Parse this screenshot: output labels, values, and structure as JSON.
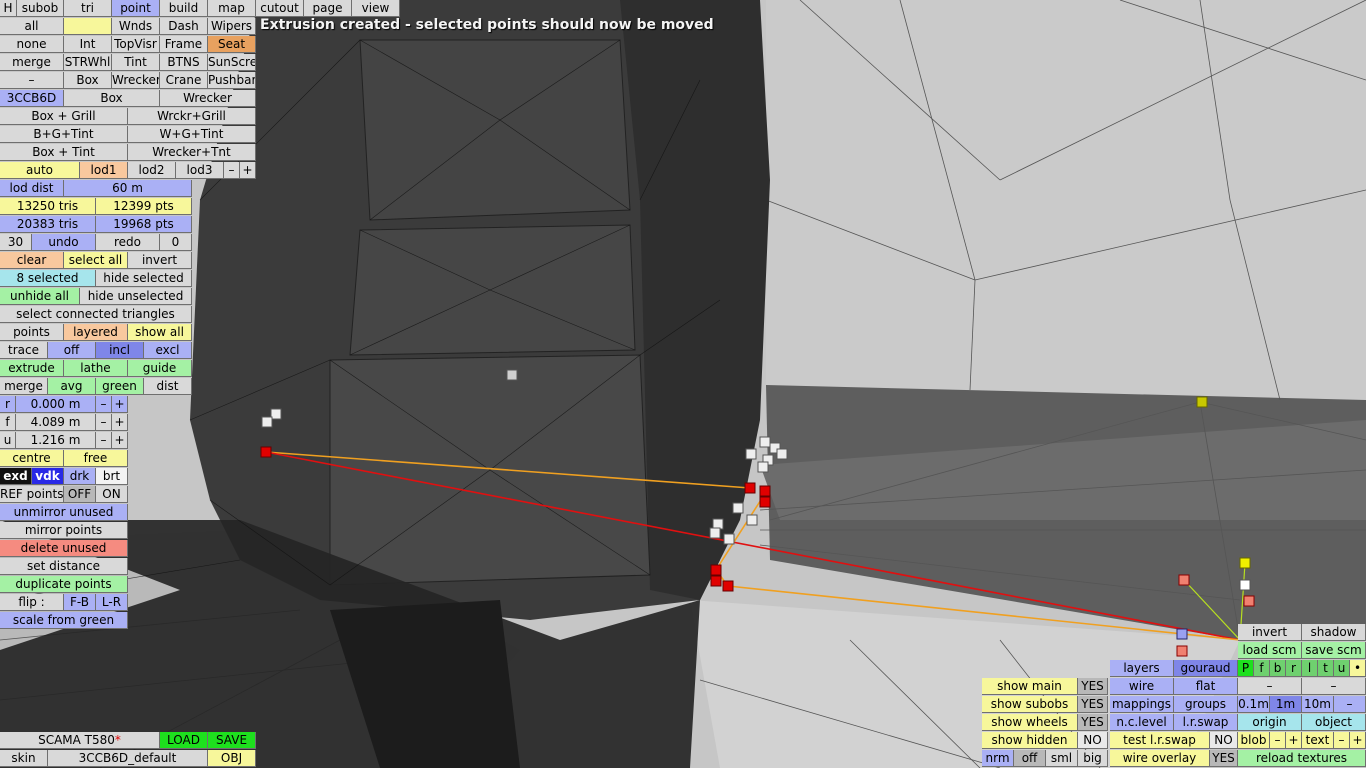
{
  "message": "Extrusion created - selected points should now be moved",
  "top": {
    "h": "H",
    "subob": "subob",
    "tri": "tri",
    "point": "point",
    "build": "build",
    "map": "map",
    "cutout": "cutout",
    "page": "page",
    "view": "view"
  },
  "parts": {
    "all": "all",
    "wnds": "Wnds",
    "dash": "Dash",
    "wipers": "Wipers",
    "none": "none",
    "int": "Int",
    "topvisr": "TopVisr",
    "frame": "Frame",
    "seat": "Seat",
    "merge": "merge",
    "strwhl": "STRWhl",
    "tint": "Tint",
    "btns": "BTNS",
    "sunscre": "SunScre",
    "dash2": "–",
    "box": "Box",
    "wrecker": "Wrecker",
    "crane": "Crane",
    "pushbar": "Pushbar"
  },
  "variants": {
    "code": "3CCB6D",
    "box": "Box",
    "wrecker": "Wrecker",
    "box_grill": "Box + Grill",
    "wrckr_grill": "Wrckr+Grill",
    "bg_tint": "B+G+Tint",
    "wg_tint": "W+G+Tint",
    "box_tint": "Box + Tint",
    "wrecker_tnt": "Wrecker+Tnt"
  },
  "lod": {
    "auto": "auto",
    "lod1": "lod1",
    "lod2": "lod2",
    "lod3": "lod3",
    "minus": "–",
    "plus": "+",
    "dist_label": "lod dist",
    "dist_value": "60 m"
  },
  "stats": {
    "tris1": "13250 tris",
    "pts1": "12399 pts",
    "tris2": "20383 tris",
    "pts2": "19968 pts"
  },
  "undo": {
    "count": "30",
    "undo": "undo",
    "redo": "redo",
    "redo_count": "0"
  },
  "select": {
    "clear": "clear",
    "select_all": "select all",
    "invert": "invert",
    "selected": "8 selected",
    "hide_selected": "hide selected",
    "unhide_all": "unhide all",
    "hide_unselected": "hide unselected",
    "connected": "select connected triangles",
    "points": "points",
    "layered": "layered",
    "show_all": "show all"
  },
  "trace": {
    "trace": "trace",
    "off": "off",
    "incl": "incl",
    "excl": "excl"
  },
  "ops": {
    "extrude": "extrude",
    "lathe": "lathe",
    "guide": "guide",
    "merge": "merge",
    "avg": "avg",
    "green": "green",
    "dist": "dist"
  },
  "coords": {
    "r_label": "r",
    "r_value": "0.000 m",
    "f_label": "f",
    "f_value": "4.089 m",
    "u_label": "u",
    "u_value": "1.216 m",
    "minus": "–",
    "plus": "+"
  },
  "pivot": {
    "centre": "centre",
    "free": "free"
  },
  "shade": {
    "exd": "exd",
    "vdk": "vdk",
    "drk": "drk",
    "brt": "brt"
  },
  "refpoints": {
    "label": "REF points",
    "off": "OFF",
    "on": "ON"
  },
  "actions": {
    "unmirror": "unmirror unused",
    "mirror": "mirror points",
    "delete": "delete unused",
    "set_distance": "set distance",
    "duplicate": "duplicate points",
    "flip": "flip :",
    "fb": "F-B",
    "lr": "L-R",
    "scale": "scale from green"
  },
  "file": {
    "model": "SCAMA T580",
    "modified": "*",
    "load": "LOAD",
    "save": "SAVE",
    "skin": "skin",
    "skin_name": "3CCB6D_default",
    "obj": "OBJ"
  },
  "display": {
    "show_main": "show main",
    "show_main_v": "YES",
    "show_subobs": "show subobs",
    "show_subobs_v": "YES",
    "show_wheels": "show wheels",
    "show_wheels_v": "YES",
    "show_hidden": "show hidden",
    "show_hidden_v": "NO",
    "nrm": "nrm",
    "off": "off",
    "sml": "sml",
    "big": "big"
  },
  "render": {
    "layers": "layers",
    "gouraud": "gouraud",
    "wire": "wire",
    "flat": "flat",
    "mappings": "mappings",
    "groups": "groups",
    "nclevel": "n.c.level",
    "lrswap": "l.r.swap",
    "test_lrswap": "test l.r.swap",
    "test_lrswap_v": "NO",
    "wire_overlay": "wire overlay",
    "wire_overlay_v": "YES"
  },
  "tools": {
    "invert": "invert",
    "shadow": "shadow",
    "load_scm": "load scm",
    "save_scm": "save scm",
    "flags": [
      "P",
      "f",
      "b",
      "r",
      "l",
      "t",
      "u",
      "•"
    ],
    "dash1": "–",
    "dash2": "–",
    "g01": "0.1m",
    "g1": "1m",
    "g10": "10m",
    "gminus": "–",
    "origin": "origin",
    "object": "object",
    "blob": "blob",
    "blob_minus": "–",
    "blob_plus": "+",
    "text": "text",
    "text_minus": "–",
    "text_plus": "+",
    "reload": "reload textures"
  },
  "colors": {
    "accent_blue": "#aab0f5",
    "selected_point": "#e00000",
    "green_btn": "#a4f1a4"
  }
}
